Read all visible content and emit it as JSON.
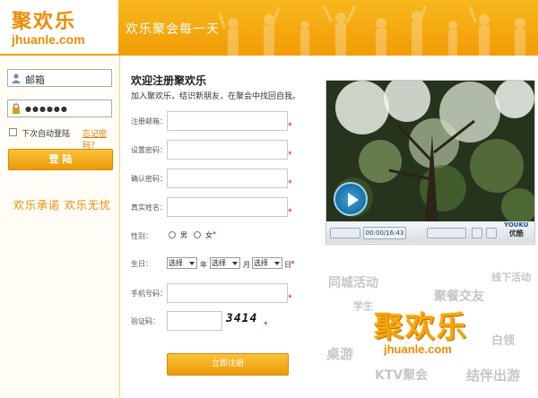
{
  "header": {
    "logo_cn": "聚欢乐",
    "logo_en": "jhuanle.com",
    "slogan": "欢乐聚会每一天"
  },
  "login": {
    "email_label": "邮箱",
    "password_mask": "●●●●●●",
    "remember_label": "下次自动登陆",
    "forgot_label": "忘记密码？",
    "login_button": "登 陆",
    "promise": "欢乐承诺  欢乐无忧"
  },
  "register": {
    "title": "欢迎注册聚欢乐",
    "subtitle": "加入聚欢乐，结识新朋友，在聚会中找回自我。",
    "labels": {
      "email": "注册邮箱：",
      "password": "设置密码：",
      "confirm": "确认密码：",
      "realname": "真实姓名：",
      "gender": "性别：",
      "birthday": "生日：",
      "phone": "手机号码：",
      "captcha": "验证码："
    },
    "gender_male": "男",
    "gender_female": "女",
    "select_placeholder": "选择",
    "year_label": "年",
    "month_label": "月",
    "day_label": "日",
    "captcha_text": "3414",
    "submit_label": "立即注册",
    "required_mark": "*"
  },
  "video": {
    "time_display": "00:00/16:43",
    "brand_top": "YOUKU",
    "brand_bottom": "优酷"
  },
  "tags": {
    "t1": "同城活动",
    "t2": "线下活动",
    "t3": "学生",
    "t4": "聚餐交友",
    "t5": "桌游",
    "t6": "白领",
    "t7": "KTV聚会",
    "t8": "结伴出游"
  },
  "brand_big": {
    "cn": "聚欢乐",
    "en": "jhuanle.com"
  },
  "colors": {
    "brand_orange": "#f08a00",
    "header_yellow": "#f7b81d",
    "required_red": "#dd0000"
  }
}
